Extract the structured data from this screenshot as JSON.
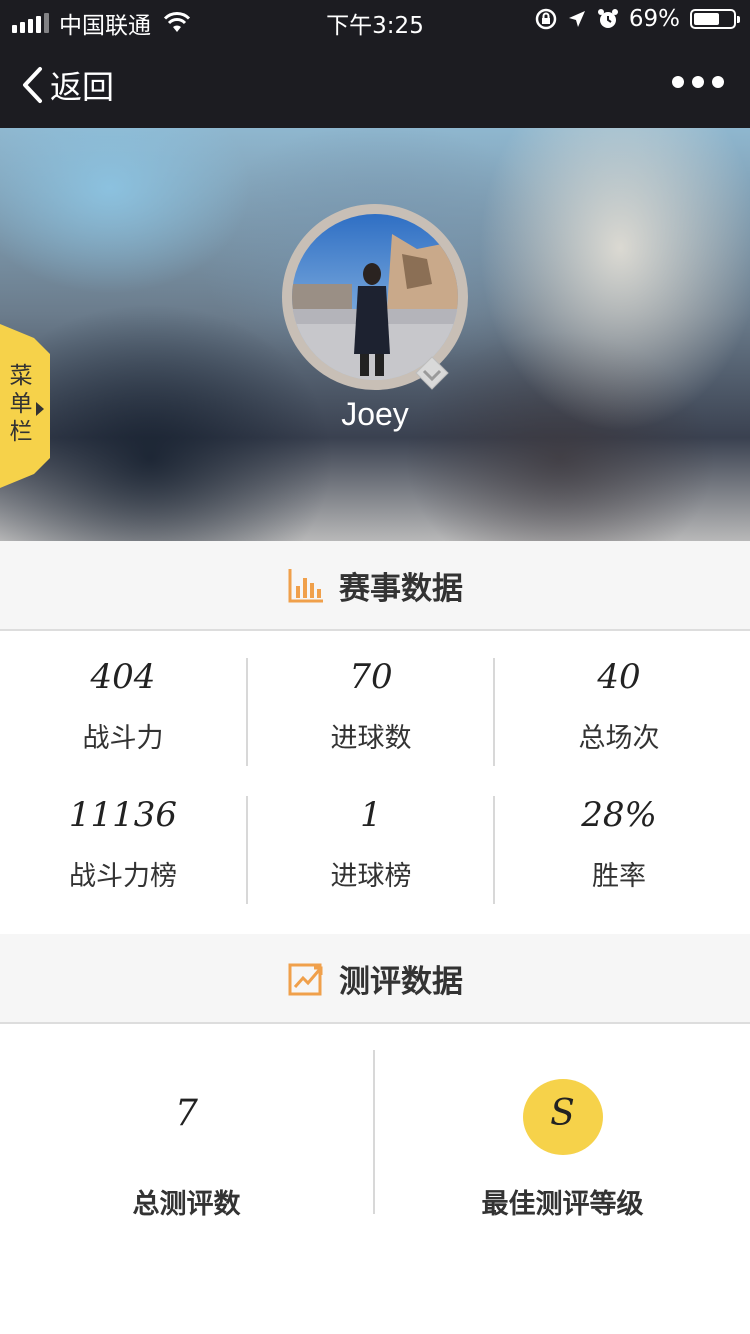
{
  "status_bar": {
    "carrier": "中国联通",
    "time": "下午3:25",
    "battery_percent": "69%",
    "battery_level": 0.69
  },
  "nav": {
    "back_label": "返回",
    "back_icon": "chevron-left-icon",
    "more_icon": "more-dots-icon"
  },
  "profile": {
    "side_menu_label": "菜单栏",
    "username": "Joey",
    "accent_color": "#f6d24a"
  },
  "match_data": {
    "title": "赛事数据",
    "icon": "bar-chart-icon",
    "stats": [
      {
        "value": "404",
        "label": "战斗力"
      },
      {
        "value": "70",
        "label": "进球数"
      },
      {
        "value": "40",
        "label": "总场次"
      },
      {
        "value": "11136",
        "label": "战斗力榜"
      },
      {
        "value": "1",
        "label": "进球榜"
      },
      {
        "value": "28%",
        "label": "胜率"
      }
    ]
  },
  "eval_data": {
    "title": "测评数据",
    "icon": "trend-chart-icon",
    "total": {
      "value": "7",
      "label": "总测评数"
    },
    "best": {
      "value": "S",
      "label": "最佳测评等级"
    }
  }
}
